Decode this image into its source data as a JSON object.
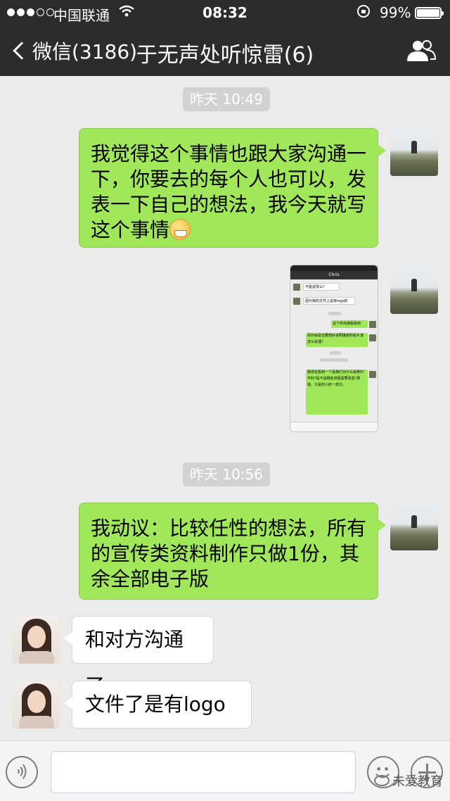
{
  "status_bar": {
    "carrier": "中国联通",
    "time": "08:32",
    "battery": "99%",
    "icons": [
      "signal-dots-icon",
      "wifi-icon",
      "rotation-lock-icon",
      "battery-icon"
    ]
  },
  "nav": {
    "back_label": "微信(3186)",
    "title": "于无声处听惊雷(6)",
    "icons": [
      "back-chevron-icon",
      "group-members-icon"
    ]
  },
  "chat": {
    "timestamps": [
      "昨天 10:49",
      "昨天 10:56"
    ],
    "messages": [
      {
        "side": "out",
        "type": "text",
        "text": "我觉得这个事情也跟大家沟通一下，你要去的每个人也可以，发表一下自己的想法，我今天就写这个事情",
        "emoji": "grin-emoji-icon"
      },
      {
        "side": "out",
        "type": "image",
        "thumbnail": {
          "nav_title": "Chris",
          "lines": [
            "不能退货么?",
            "因为我的文件上是有logo的",
            "这个你沟通看看吧",
            "另外就是也要想好说明接受的名片该怎么处理?",
            "我现在看到一个是我们为什么给修印不好?是不是哪些流程需要改善?费钱。只是你小的一部分。"
          ]
        }
      },
      {
        "side": "out",
        "type": "text",
        "text": "我动议：比较任性的想法，所有的宣传类资料制作只做1份，其余全部电子版"
      },
      {
        "side": "in",
        "type": "text",
        "text": "和对方沟通了"
      },
      {
        "side": "in",
        "type": "text",
        "text": "文件了是有logo的"
      }
    ]
  },
  "input_bar": {
    "value": "",
    "icons": [
      "voice-icon",
      "emoji-icon",
      "plus-icon"
    ]
  },
  "watermark": "未爱教育",
  "colors": {
    "nav_bg": "#2c2c2e",
    "chat_bg": "#ebebeb",
    "out_bubble": "#a0e75a",
    "in_bubble": "#ffffff"
  }
}
